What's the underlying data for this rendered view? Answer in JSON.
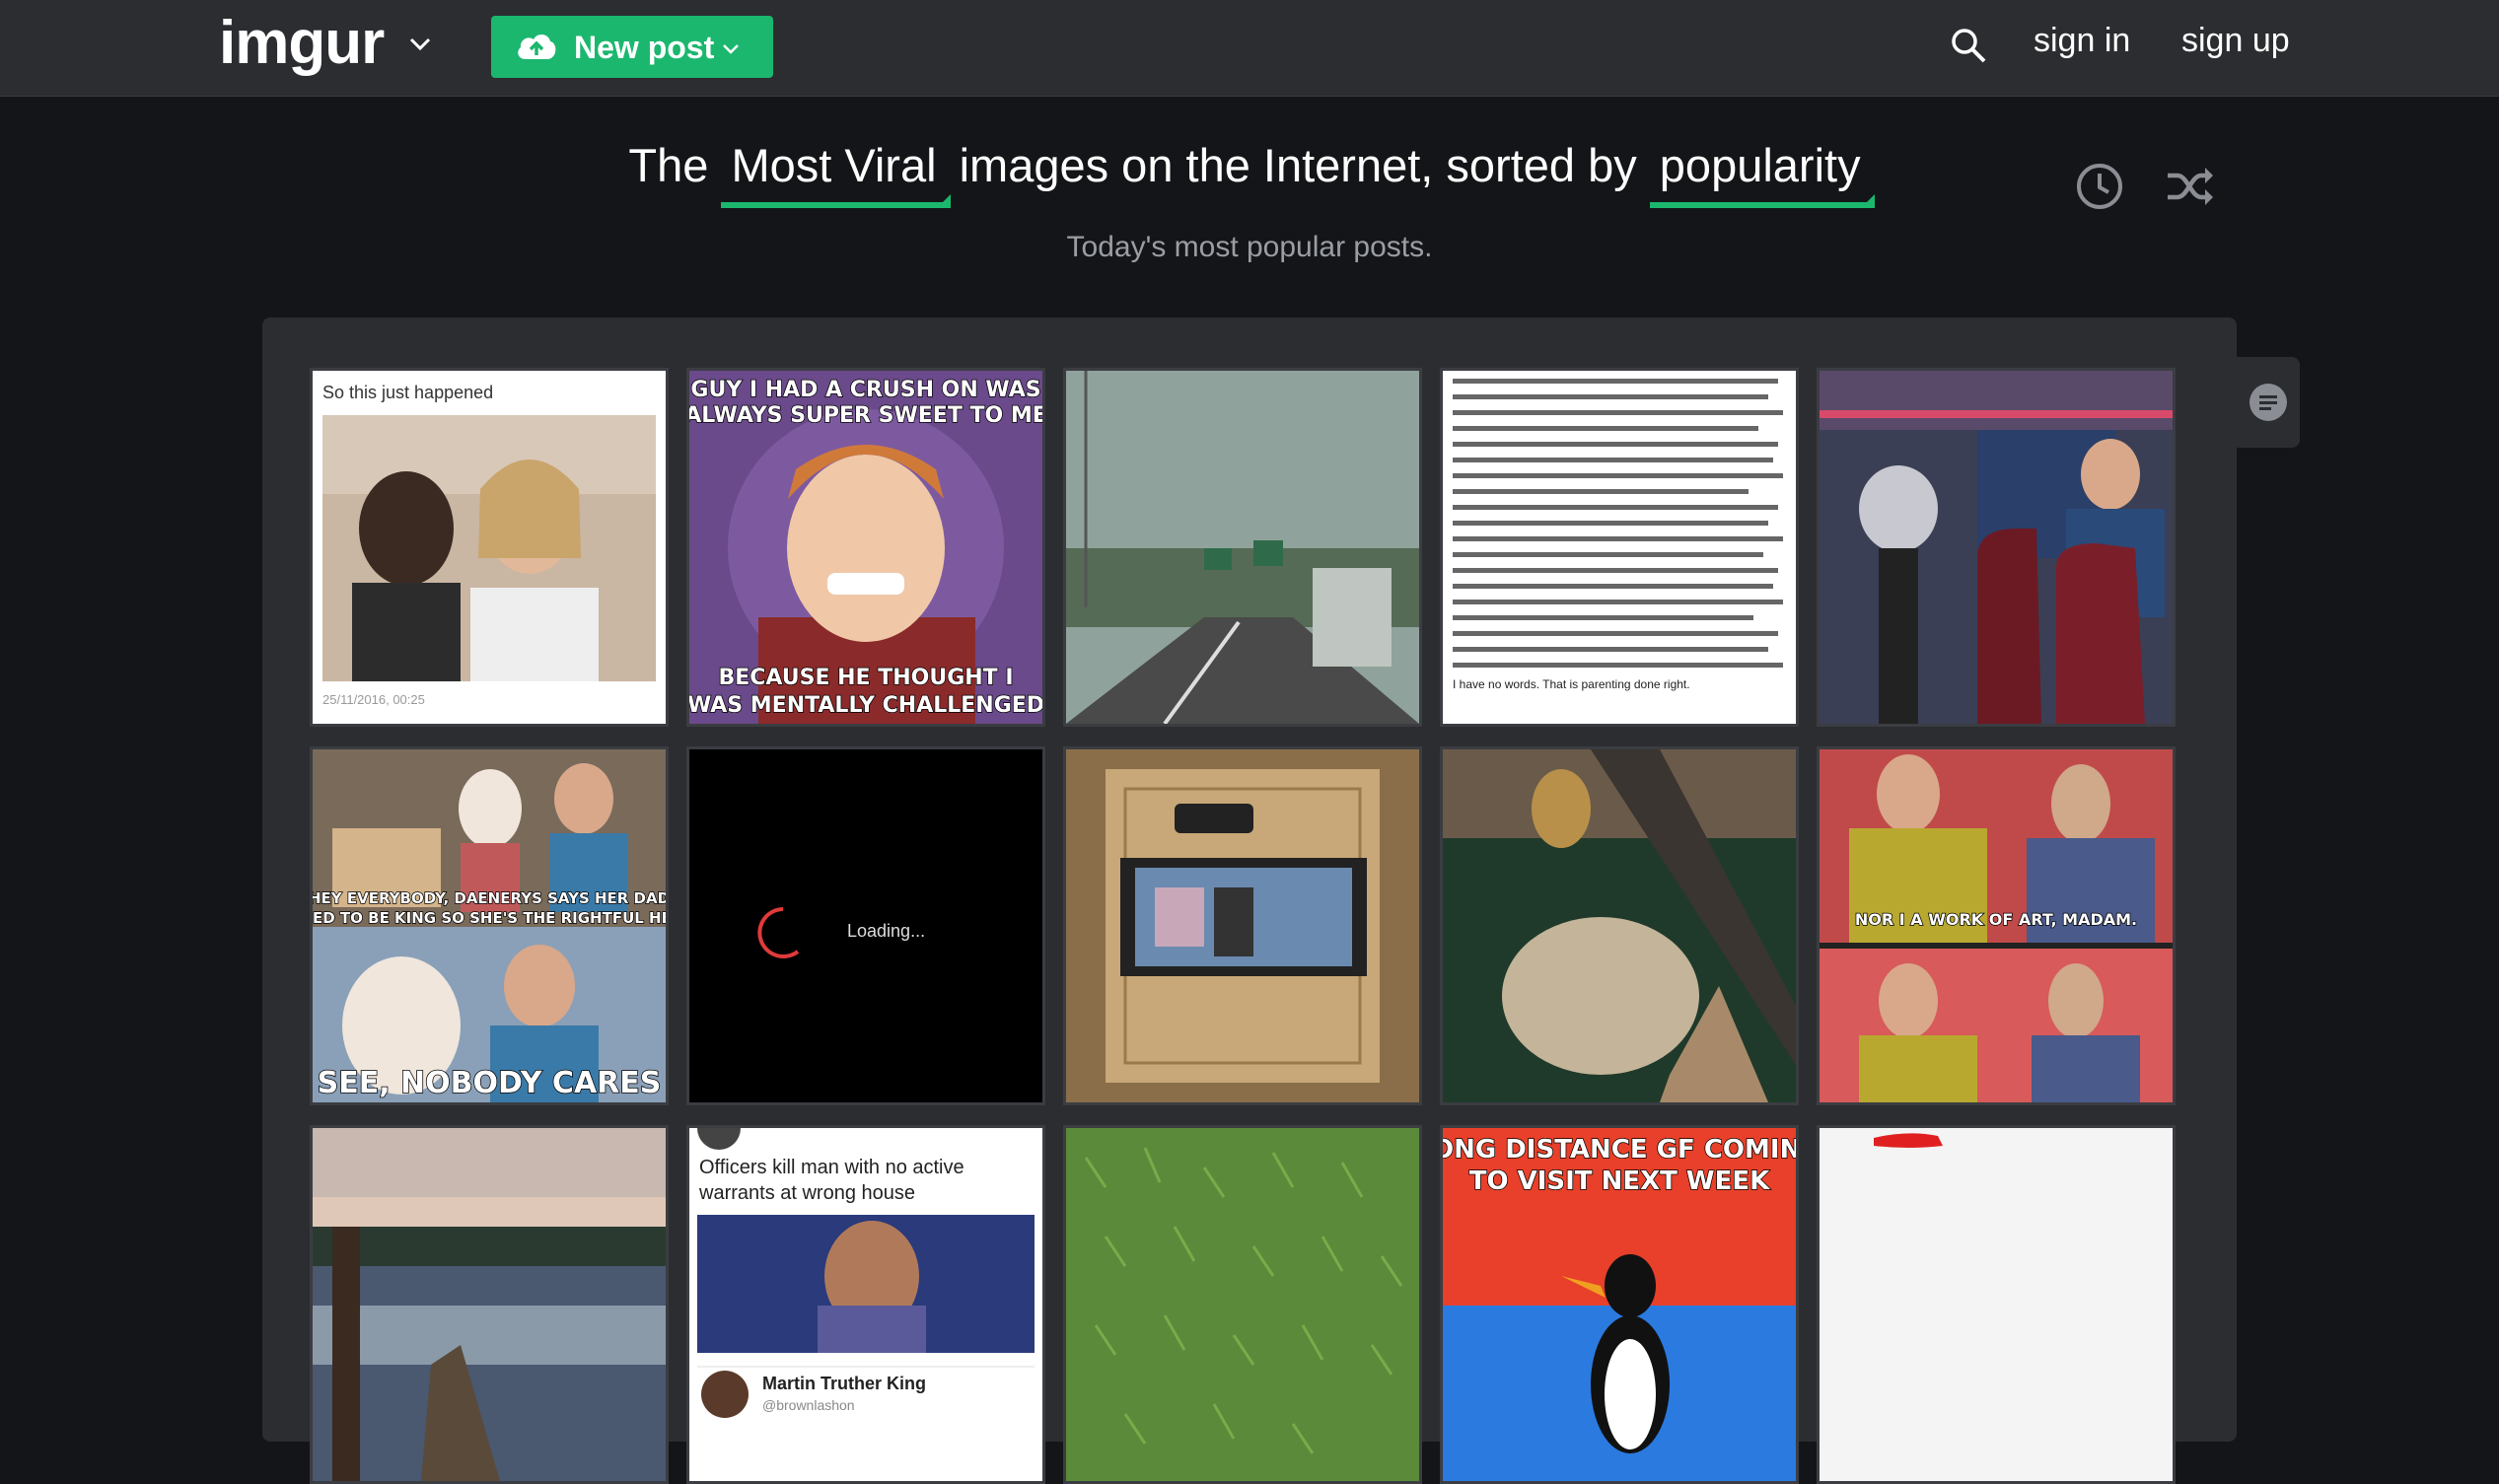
{
  "nav": {
    "logo": "imgur",
    "new_post_label": "New post",
    "sign_in": "sign in",
    "sign_up": "sign up"
  },
  "heading": {
    "prefix": "The",
    "section": "Most Viral",
    "middle": "images on the Internet, sorted by",
    "sort": "popularity",
    "subtitle": "Today's most popular posts."
  },
  "colors": {
    "accent": "#1bb76e",
    "topbar": "#2b2d30",
    "background": "#141518"
  },
  "icons": [
    "chevron-down-icon",
    "cloud-upload-icon",
    "search-icon",
    "clock-icon",
    "shuffle-icon",
    "comment-icon"
  ],
  "tiles": [
    {
      "caption": "So this just happened",
      "footer": "25/11/2016, 00:25"
    },
    {
      "top": "GUY I HAD A CRUSH ON WAS ALWAYS SUPER SWEET TO ME",
      "bottom": "BECAUSE HE THOUGHT I WAS MENTALLY CHALLENGED"
    },
    {},
    {
      "last_line": "I have no words. That is parenting done right."
    },
    {},
    {
      "top": "HEY EVERYBODY, DAENERYS SAYS HER DAD USED TO BE KING SO SHE'S THE RIGHTFUL HEIR",
      "bottom": "SEE, NOBODY CARES"
    },
    {
      "loading": "Loading..."
    },
    {},
    {},
    {
      "caption": "NOR I A WORK OF ART, MADAM."
    },
    {},
    {
      "headline": "Officers kill man with no active warrants at wrong house",
      "author": "Martin Truther King",
      "handle": "@brownlashon"
    },
    {},
    {
      "top": "LONG DISTANCE GF COMING TO VISIT NEXT WEEK"
    },
    {}
  ]
}
